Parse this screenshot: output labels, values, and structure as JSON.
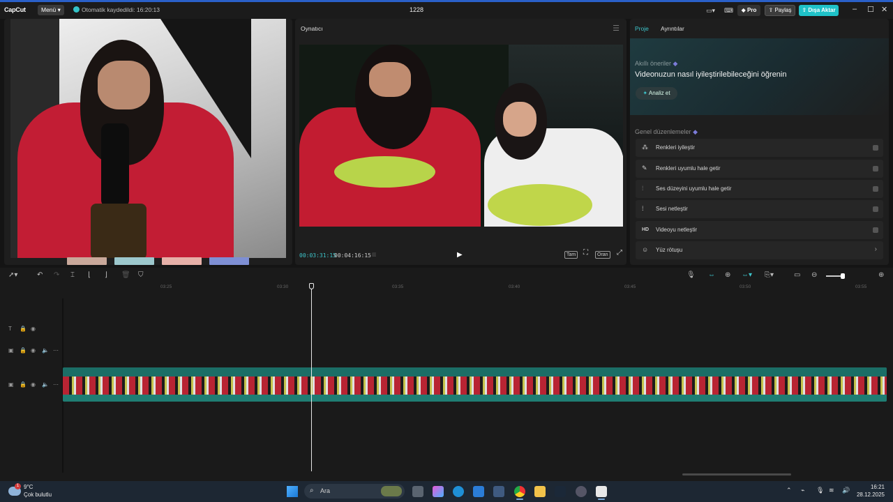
{
  "titlebar": {
    "logo": "CapCut",
    "menu_label": "Menü",
    "autosave_text": "Otomatik kaydedildi: 16:20:13",
    "project_name": "1228",
    "pro_label": "Pro",
    "share_label": "Paylaş",
    "export_label": "Dışa Aktar"
  },
  "player": {
    "title": "Oynatıcı",
    "current_time": "00:03:31:15",
    "total_time": "00:04:16:15",
    "full_label": "Tam",
    "ratio_label": "Oran"
  },
  "right_panel": {
    "tabs": [
      "Proje",
      "Ayrıntılar"
    ],
    "smart_label": "Akıllı öneriler",
    "smart_title": "Videonuzun nasıl iyileştirilebileceğini öğrenin",
    "analyze_label": "Analiz et",
    "general_label": "Genel düzenlemeler",
    "options": [
      {
        "label": "Renkleri iyileştir",
        "icon": "magic-wand-icon"
      },
      {
        "label": "Renkleri uyumlu hale getir",
        "icon": "color-match-icon"
      },
      {
        "label": "Ses düzeyini uyumlu hale getir",
        "icon": "volume-sliders-icon"
      },
      {
        "label": "Sesi netleştir",
        "icon": "audio-wave-icon"
      },
      {
        "label": "Videoyu netleştir",
        "icon": "hd-icon"
      },
      {
        "label": "Yüz rötuşu",
        "icon": "face-retouch-icon"
      }
    ]
  },
  "timeline": {
    "ruler_ticks": [
      "03:25",
      "03:30",
      "03:35",
      "03:40",
      "03:45",
      "03:50",
      "03:55"
    ]
  },
  "taskbar": {
    "temperature": "9°C",
    "weather_condition": "Çok bulutlu",
    "weather_badge": "1",
    "search_placeholder": "Ara",
    "time": "16:21",
    "date": "28.12.2025"
  },
  "colors": {
    "accent": "#3ec6cc",
    "export_bg": "#1fc2c8",
    "clip_bg": "#1a5c58"
  }
}
